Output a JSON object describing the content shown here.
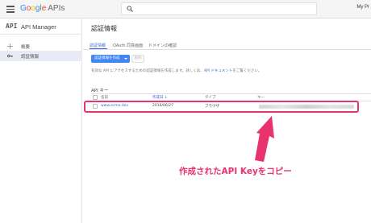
{
  "topbar": {
    "logo_letters": [
      "G",
      "o",
      "o",
      "g",
      "l",
      "e"
    ],
    "logo_suffix": "APIs",
    "search_placeholder": "",
    "project_label": "My Pr"
  },
  "sidebar": {
    "mark": "API",
    "title": "API Manager",
    "items": [
      {
        "label": "概要",
        "icon": "overview-icon"
      },
      {
        "label": "認証情報",
        "icon": "key-icon",
        "active": true
      }
    ]
  },
  "main": {
    "page_title": "認証情報",
    "tabs": [
      "認証情報",
      "OAuth 同意画面",
      "ドメインの確認"
    ],
    "create_button": "認証情報を作成",
    "delete_button": "削除",
    "description_prefix": "有効な API にアクセスするための認証情報を作成します。詳しくは、",
    "description_link": "API ドキュメント",
    "description_suffix": "をご覧ください。",
    "section_title": "API キー",
    "table": {
      "headers": [
        "名前",
        "作成日",
        "タイプ",
        "キー"
      ],
      "sorted_header_arrow": "↓",
      "rows": [
        {
          "name": "www.ecmo.dev",
          "created": "2016/06/27",
          "type": "ブラウザ",
          "key": ""
        }
      ]
    }
  },
  "annotation": {
    "callout": "作成されたAPI Keyをコピー",
    "color": "#e8336e"
  },
  "colors": {
    "accent": "#4285f4",
    "link": "#3367d6",
    "highlight": "#e8336e"
  }
}
